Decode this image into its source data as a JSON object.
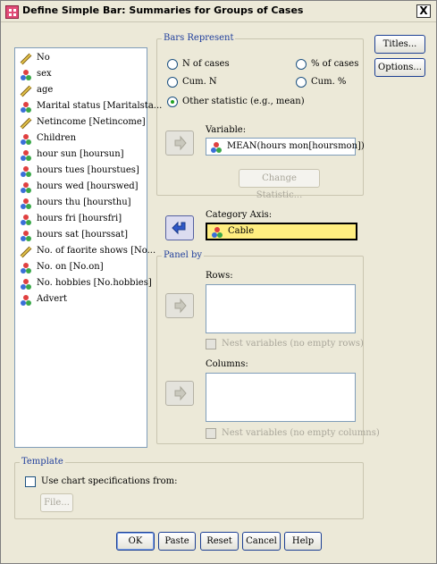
{
  "window": {
    "title": "Define Simple Bar: Summaries for Groups of Cases",
    "close": "X"
  },
  "variables": [
    {
      "label": "No",
      "icon": "scale-ruler-icon"
    },
    {
      "label": "sex",
      "icon": "nominal-icon"
    },
    {
      "label": "age",
      "icon": "scale-ruler-icon"
    },
    {
      "label": "Marital status [Maritalsta...",
      "icon": "nominal-icon"
    },
    {
      "label": "Netincome [Netincome]",
      "icon": "scale-ruler-icon"
    },
    {
      "label": "Children",
      "icon": "nominal-icon"
    },
    {
      "label": "hour sun [hoursun]",
      "icon": "nominal-icon"
    },
    {
      "label": "hours tues [hourstues]",
      "icon": "nominal-icon"
    },
    {
      "label": "hours wed [hourswed]",
      "icon": "nominal-icon"
    },
    {
      "label": "hours thu [hoursthu]",
      "icon": "nominal-icon"
    },
    {
      "label": "hours fri [hoursfri]",
      "icon": "nominal-icon"
    },
    {
      "label": "hours sat [hourssat]",
      "icon": "nominal-icon"
    },
    {
      "label": "No. of faorite shows [No...",
      "icon": "scale-ruler-icon"
    },
    {
      "label": "No. on [No.on]",
      "icon": "nominal-icon"
    },
    {
      "label": "No. hobbies [No.hobbies]",
      "icon": "nominal-icon"
    },
    {
      "label": "Advert",
      "icon": "nominal-icon"
    }
  ],
  "bars_represent": {
    "title": "Bars Represent",
    "options": {
      "n_cases": "N of cases",
      "pct_cases": "% of cases",
      "cum_n": "Cum. N",
      "cum_pct": "Cum. %",
      "other": "Other statistic (e.g., mean)"
    },
    "selected": "other",
    "variable_label": "Variable:",
    "variable_value": "MEAN(hours mon[hoursmon])",
    "change_statistic": "Change Statistic..."
  },
  "category_axis": {
    "label": "Category Axis:",
    "value": "Cable"
  },
  "panel_by": {
    "title": "Panel by",
    "rows_label": "Rows:",
    "rows_nest": "Nest variables (no empty rows)",
    "columns_label": "Columns:",
    "columns_nest": "Nest variables (no empty columns)"
  },
  "template": {
    "title": "Template",
    "use_chart": "Use chart specifications from:",
    "file_button": "File..."
  },
  "side_buttons": {
    "titles": "Titles...",
    "options": "Options..."
  },
  "bottom_buttons": {
    "ok": "OK",
    "paste": "Paste",
    "reset": "Reset",
    "cancel": "Cancel",
    "help": "Help"
  },
  "colors": {
    "group_title": "#1f3e9c",
    "selected_field": "#ffee80",
    "button_border": "#1c3f93"
  }
}
